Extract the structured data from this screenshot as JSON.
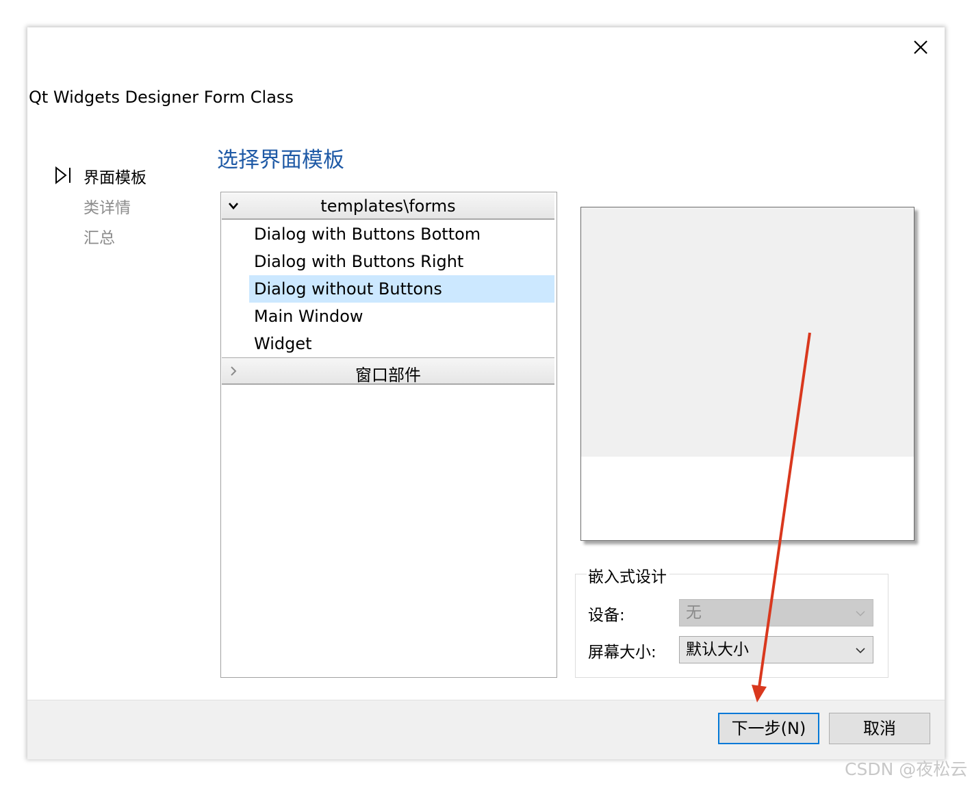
{
  "window": {
    "title": "Qt Widgets Designer Form Class",
    "close_icon": "close-icon"
  },
  "wizard_steps": [
    {
      "label": "界面模板",
      "state": "current"
    },
    {
      "label": "类详情",
      "state": "pending"
    },
    {
      "label": "汇总",
      "state": "pending"
    }
  ],
  "page_heading": "选择界面模板",
  "tree": {
    "groups": [
      {
        "label": "templates\\forms",
        "expanded": true,
        "items": [
          {
            "label": "Dialog with Buttons Bottom",
            "selected": false
          },
          {
            "label": "Dialog with Buttons Right",
            "selected": false
          },
          {
            "label": "Dialog without Buttons",
            "selected": true
          },
          {
            "label": "Main Window",
            "selected": false
          },
          {
            "label": "Widget",
            "selected": false
          }
        ]
      },
      {
        "label": "窗口部件",
        "expanded": false
      }
    ]
  },
  "embedded_design": {
    "title": "嵌入式设计",
    "device_label": "设备:",
    "device_value": "无",
    "screen_size_label": "屏幕大小:",
    "screen_size_value": "默认大小"
  },
  "buttons": {
    "next": "下一步(N)",
    "cancel": "取消"
  },
  "watermark": "CSDN @夜松云",
  "colors": {
    "heading": "#1f5aa6",
    "selection": "#cce8ff",
    "primary_border": "#0078d7",
    "annotation_arrow": "#d9381e"
  }
}
